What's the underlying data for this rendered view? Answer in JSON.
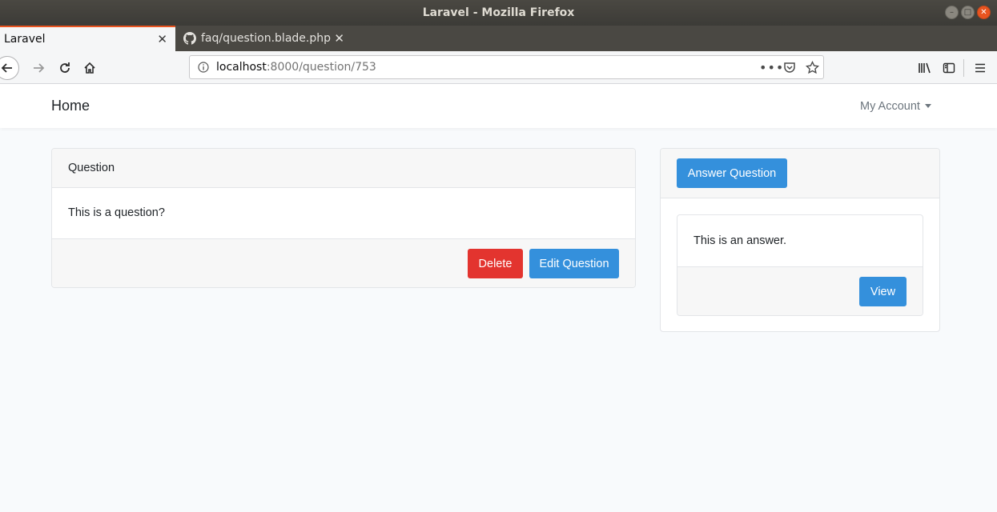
{
  "window": {
    "title": "Laravel - Mozilla Firefox"
  },
  "tabs": [
    {
      "label": "Laravel",
      "active": true
    },
    {
      "label": "faq/question.blade.php",
      "active": false,
      "icon": "github-icon"
    }
  ],
  "address_bar": {
    "host": "localhost",
    "path": ":8000/question/753"
  },
  "site_nav": {
    "brand": "Home",
    "account_label": "My Account"
  },
  "question_card": {
    "header": "Question",
    "body": "This is a question?",
    "delete_label": "Delete",
    "edit_label": "Edit Question"
  },
  "answers_panel": {
    "answer_button_label": "Answer Question",
    "answers": [
      {
        "text": "This is an answer.",
        "view_label": "View"
      }
    ]
  },
  "colors": {
    "primary": "#3490dc",
    "danger": "#e3342f",
    "accent": "#e95420"
  }
}
